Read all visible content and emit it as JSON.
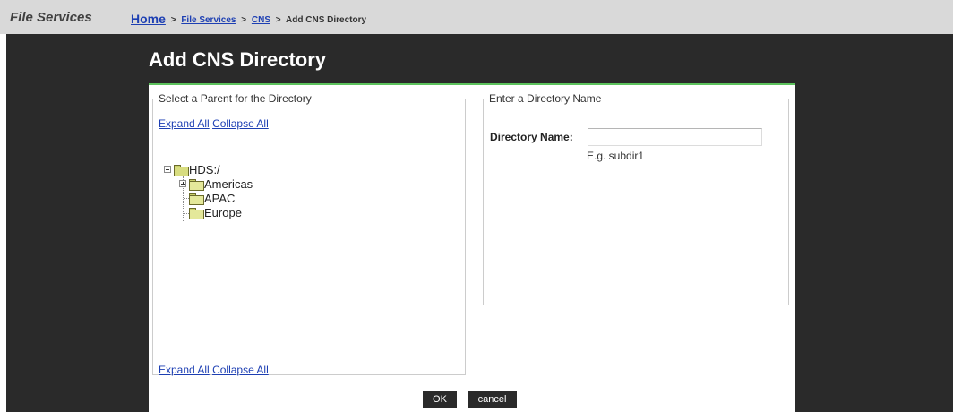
{
  "header": {
    "section_title": "File Services",
    "breadcrumb": {
      "home": "Home",
      "separator": ">",
      "file_services": "File Services",
      "cns": "CNS",
      "current": "Add CNS Directory"
    }
  },
  "page": {
    "title": "Add CNS Directory",
    "accent_color": "#5cc25c"
  },
  "parent_panel": {
    "legend": "Select a Parent for the Directory",
    "expand_all": "Expand All",
    "collapse_all": "Collapse All",
    "tree": {
      "root": {
        "label": "HDS:/",
        "expanded": true
      },
      "children": [
        {
          "label": "Americas",
          "has_children": true
        },
        {
          "label": "APAC",
          "has_children": false
        },
        {
          "label": "Europe",
          "has_children": false
        }
      ]
    }
  },
  "name_panel": {
    "legend": "Enter a Directory Name",
    "label": "Directory Name:",
    "value": "",
    "hint": "E.g. subdir1"
  },
  "actions": {
    "ok": "OK",
    "cancel": "cancel"
  }
}
